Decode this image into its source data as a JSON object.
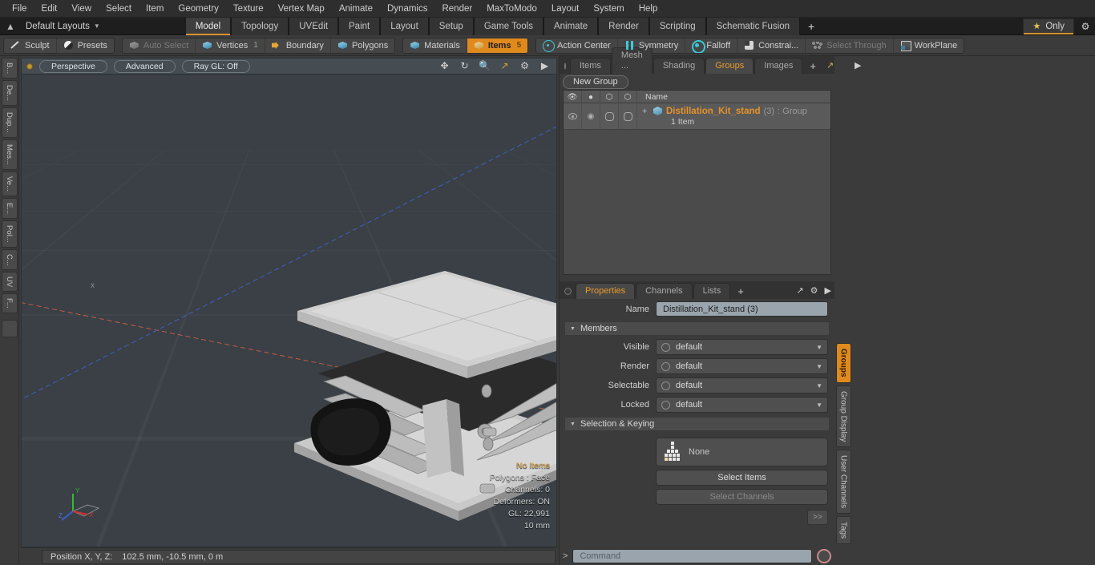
{
  "app": {
    "menu": [
      "File",
      "Edit",
      "View",
      "Select",
      "Item",
      "Geometry",
      "Texture",
      "Vertex Map",
      "Animate",
      "Dynamics",
      "Render",
      "MaxToModo",
      "Layout",
      "System",
      "Help"
    ],
    "layout_label": "Default Layouts",
    "home_icon": "home-icon",
    "layout_tabs": [
      {
        "label": "Model",
        "active": true
      },
      {
        "label": "Topology",
        "active": false
      },
      {
        "label": "UVEdit",
        "active": false
      },
      {
        "label": "Paint",
        "active": false
      },
      {
        "label": "Layout",
        "active": false
      },
      {
        "label": "Setup",
        "active": false
      },
      {
        "label": "Game Tools",
        "active": false
      },
      {
        "label": "Animate",
        "active": false
      },
      {
        "label": "Render",
        "active": false
      },
      {
        "label": "Scripting",
        "active": false
      },
      {
        "label": "Schematic Fusion",
        "active": false
      }
    ],
    "add_tab_label": "+",
    "only_label": "Only",
    "accent": "#e08a1e"
  },
  "modebar": {
    "group1": [
      {
        "label": "Sculpt",
        "icon": "pencil-icon",
        "state": "normal",
        "count": ""
      },
      {
        "label": "Presets",
        "icon": "sphere-icon",
        "state": "normal",
        "count": ""
      }
    ],
    "group2": [
      {
        "label": "Auto Select",
        "icon": "cube-grey-icon",
        "state": "disabled",
        "count": ""
      },
      {
        "label": "Vertices",
        "icon": "cube-blue-icon",
        "state": "normal",
        "count": "1"
      },
      {
        "label": "Boundary",
        "icon": "arrow-icon",
        "state": "normal",
        "count": ""
      },
      {
        "label": "Polygons",
        "icon": "cube-blue-icon",
        "state": "normal",
        "count": ""
      }
    ],
    "group3": [
      {
        "label": "Materials",
        "icon": "cube-blue-icon",
        "state": "normal",
        "count": ""
      },
      {
        "label": "Items",
        "icon": "cube-gold-icon",
        "state": "selected",
        "count": "5"
      }
    ],
    "group4": [
      {
        "label": "Action Center",
        "icon": "target-icon",
        "state": "normal",
        "count": ""
      },
      {
        "label": "Symmetry",
        "icon": "symmetry-icon",
        "state": "normal",
        "count": ""
      },
      {
        "label": "Falloff",
        "icon": "falloff-icon",
        "state": "normal",
        "count": ""
      },
      {
        "label": "Constrai...",
        "icon": "constraint-icon",
        "state": "normal",
        "count": ""
      },
      {
        "label": "Select Through",
        "icon": "select-through-icon",
        "state": "disabled",
        "count": ""
      },
      {
        "label": "WorkPlane",
        "icon": "workplane-icon",
        "state": "normal",
        "count": ""
      }
    ]
  },
  "left_rail": {
    "tabs": [
      "B...",
      "De...",
      "Dup...",
      "Mes...",
      "Ve...",
      "E...",
      "Pol...",
      "C...",
      "UV",
      "F..."
    ]
  },
  "viewport": {
    "header": {
      "dot": "viewport-indicator",
      "buttons": [
        "Perspective",
        "Advanced",
        "Ray GL: Off"
      ],
      "icons": [
        "move-icon",
        "rotate-icon",
        "zoom-icon",
        "fit-icon",
        "gear-icon",
        "play-icon"
      ]
    },
    "axis_labels": [
      "x",
      "z"
    ],
    "stats": [
      {
        "text": "No Items",
        "highlight": true
      },
      {
        "text": "Polygons : Face",
        "highlight": false
      },
      {
        "text": "Channels: 0",
        "highlight": false
      },
      {
        "text": "Deformers: ON",
        "highlight": false
      },
      {
        "text": "GL: 22,991",
        "highlight": false
      },
      {
        "text": "10 mm",
        "highlight": false
      }
    ],
    "gizmo_axes": [
      "Y",
      "X",
      "Z"
    ]
  },
  "statusbar": {
    "position_label": "Position X, Y, Z:",
    "position_value": "102.5 mm, -10.5 mm, 0 m"
  },
  "right_panel": {
    "tabs": [
      {
        "label": "Items",
        "active": false
      },
      {
        "label": "Mesh ...",
        "active": false
      },
      {
        "label": "Shading",
        "active": false
      },
      {
        "label": "Groups",
        "active": true
      },
      {
        "label": "Images",
        "active": false
      }
    ],
    "add_tab": "+",
    "tool_icons": [
      "expand-icon",
      "gear-icon",
      "play-icon"
    ],
    "new_group_label": "New Group",
    "list": {
      "columns": [
        "visible-eye-icon",
        "render-icon",
        "selectable-icon",
        "locked-icon",
        "Name"
      ],
      "rows": [
        {
          "expander": "+",
          "icon": "group-cube-icon",
          "name": "Distillation_Kit_stand",
          "count": "(3)",
          "type": ": Group",
          "subtext": "1 Item"
        }
      ]
    }
  },
  "properties": {
    "tabs": [
      {
        "label": "Properties",
        "active": true
      },
      {
        "label": "Channels",
        "active": false
      },
      {
        "label": "Lists",
        "active": false
      }
    ],
    "add_tab": "+",
    "tool_icons": [
      "expand-icon",
      "gear-icon",
      "play-icon"
    ],
    "name_label": "Name",
    "name_value": "Distillation_Kit_stand (3)",
    "members_header": "Members",
    "members": [
      {
        "label": "Visible",
        "value": "default"
      },
      {
        "label": "Render",
        "value": "default"
      },
      {
        "label": "Selectable",
        "value": "default"
      },
      {
        "label": "Locked",
        "value": "default"
      }
    ],
    "selection_header": "Selection & Keying",
    "selection_set_value": "None",
    "buttons": [
      {
        "label": "Select Items",
        "disabled": false
      },
      {
        "label": "Select Channels",
        "disabled": true
      }
    ],
    "more_button": ">>"
  },
  "right_rail": {
    "tabs": [
      {
        "label": "Groups",
        "active": true
      },
      {
        "label": "Group Display",
        "active": false
      },
      {
        "label": "User Channels",
        "active": false
      },
      {
        "label": "Tags",
        "active": false
      }
    ]
  },
  "command_bar": {
    "prompt": ">",
    "placeholder": "Command",
    "record_icon": "record-icon"
  }
}
